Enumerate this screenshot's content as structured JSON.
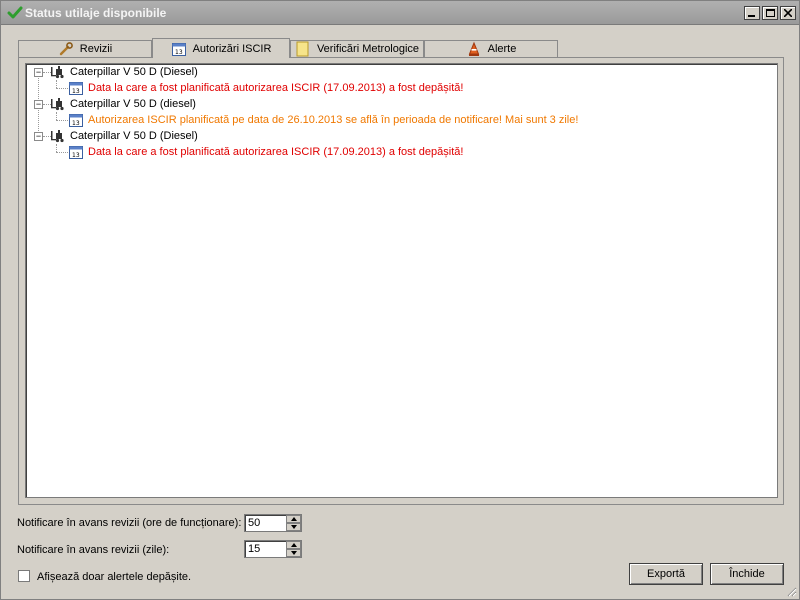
{
  "window": {
    "title": "Status utilaje disponibile",
    "titlebar_color": "#9a9a9a",
    "icons": {
      "app": "checkmark-icon",
      "minimize": "minimize-icon",
      "maximize": "maximize-icon",
      "close": "close-icon"
    }
  },
  "tabs": [
    {
      "label": "Revizii",
      "icon": "wrench-icon",
      "active": false
    },
    {
      "label": "Autorizări ISCIR",
      "icon": "calendar-icon",
      "active": true
    },
    {
      "label": "Verificări Metrologice",
      "icon": "sticky-note-icon",
      "active": false
    },
    {
      "label": "Alerte",
      "icon": "alert-cone-icon",
      "active": false
    }
  ],
  "tree": {
    "items": [
      {
        "machine": "Caterpillar  V 50 D (Diesel)",
        "message": "Data la care a fost planificată autorizarea ISCIR (17.09.2013) a fost depășită!",
        "severity": "red"
      },
      {
        "machine": "Caterpillar  V 50 D (diesel)",
        "message": "Autorizarea ISCIR planificată pe data de 26.10.2013 se află în perioada de notificare! Mai sunt 3 zile!",
        "severity": "orange"
      },
      {
        "machine": "Caterpillar  V 50 D (Diesel)",
        "message": "Data la care a fost planificată autorizarea ISCIR (17.09.2013) a fost depășită!",
        "severity": "red"
      }
    ],
    "expander_symbol": "−",
    "colors": {
      "red": "#e00000",
      "orange": "#f07800"
    },
    "icons": {
      "machine": "forklift-icon",
      "message": "calendar-icon"
    }
  },
  "settings": {
    "revisions_hours_label": "Notificare în avans revizii (ore de funcționare):",
    "revisions_hours_value": "50",
    "revisions_days_label": "Notificare în avans revizii (zile):",
    "revisions_days_value": "15",
    "only_overdue_label": "Afișează doar alertele depășite.",
    "only_overdue_checked": false
  },
  "buttons": {
    "export": "Exportă",
    "close": "Închide"
  }
}
